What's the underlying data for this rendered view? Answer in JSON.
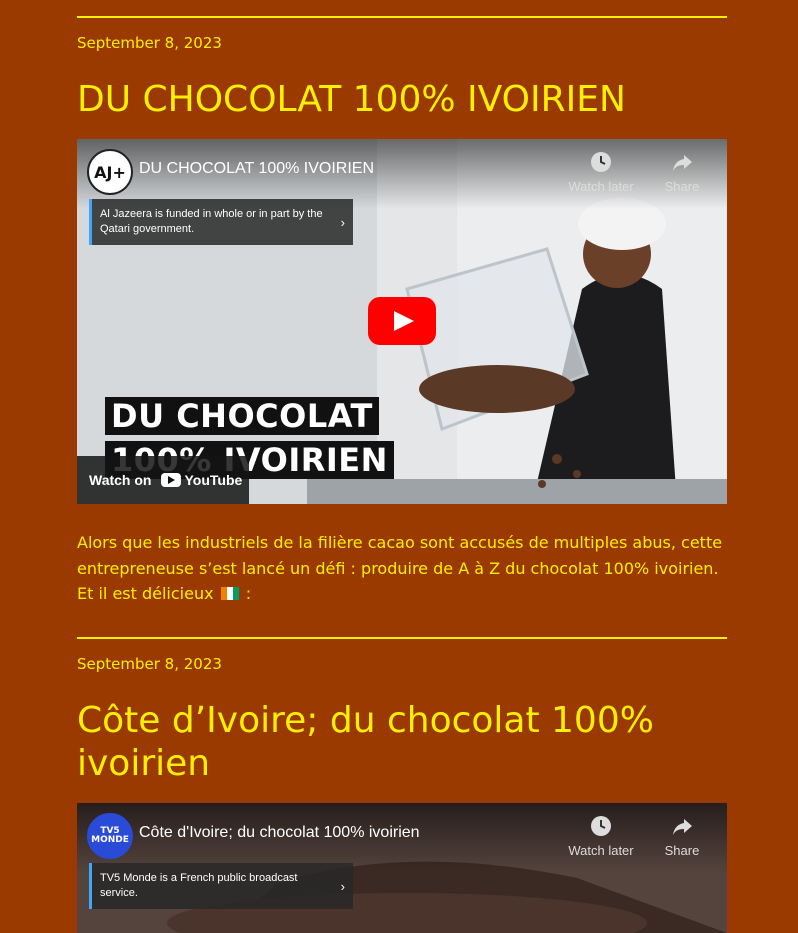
{
  "posts": [
    {
      "date": "September 8, 2023",
      "title": "DU CHOCOLAT 100% IVOIRIEN",
      "video": {
        "channel_logo_text": "AJ+",
        "title": "DU CHOCOLAT 100% IVOIRIEN",
        "watch_later": "Watch later",
        "share": "Share",
        "funding_notice": "Al Jazeera is funded in whole or in part by the Qatari government.",
        "overlay_line1": "DU CHOCOLAT",
        "overlay_line2": "100% IVOIRIEN",
        "watch_on": "Watch on",
        "youtube": "YouTube"
      },
      "body": "Alors que les industriels de la filière cacao sont accusés de multiples abus, cette entrepreneuse s’est lancé un défi : produire de A à Z du chocolat 100% ivoirien. Et il est délicieux",
      "body_end": " :"
    },
    {
      "date": "September 8, 2023",
      "title": "Côte d’Ivoire; du chocolat 100% ivoirien",
      "video": {
        "channel_logo_text": "TV5 MONDE",
        "title": "Côte d'Ivoire; du chocolat 100% ivoirien",
        "watch_later": "Watch later",
        "share": "Share",
        "funding_notice": "TV5 Monde is a French public broadcast service."
      }
    }
  ],
  "colors": {
    "background": "#9a3a00",
    "text": "#ffef00",
    "play_button": "#ff0000"
  }
}
